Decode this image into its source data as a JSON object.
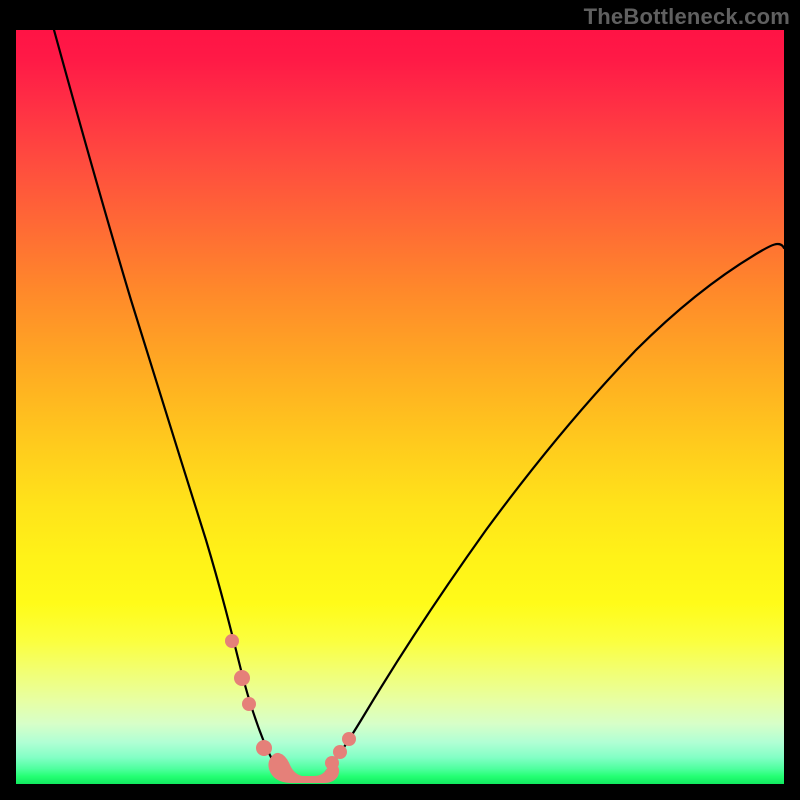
{
  "watermark": "TheBottleneck.com",
  "colors": {
    "background": "#000000",
    "gradient_top": "#ff1345",
    "gradient_mid": "#fff218",
    "gradient_bottom": "#11e95f",
    "curve": "#000000",
    "marker": "#e58079"
  },
  "chart_data": {
    "type": "line",
    "title": "",
    "xlabel": "",
    "ylabel": "",
    "xlim": [
      0,
      100
    ],
    "ylim": [
      0,
      100
    ],
    "background_gradient": {
      "orientation": "vertical",
      "stops": [
        {
          "pos": 0,
          "color": "#ff1345"
        },
        {
          "pos": 50,
          "color": "#ffcb1d"
        },
        {
          "pos": 80,
          "color": "#fbff3e"
        },
        {
          "pos": 100,
          "color": "#11e95f"
        }
      ]
    },
    "series": [
      {
        "name": "left-curve",
        "x": [
          5,
          7,
          9,
          11,
          13,
          15,
          17,
          19,
          21,
          23,
          25,
          27,
          28.5,
          30,
          31,
          32,
          33.5,
          35
        ],
        "y": [
          100,
          90,
          81,
          73,
          65.5,
          58.5,
          52,
          46,
          40,
          34,
          28,
          22,
          17,
          12,
          8.5,
          5.5,
          3,
          1
        ]
      },
      {
        "name": "right-curve",
        "x": [
          40,
          42,
          44,
          47,
          50,
          54,
          58,
          62,
          66,
          70,
          74,
          78,
          82,
          86,
          90,
          94,
          97,
          100
        ],
        "y": [
          1,
          3.5,
          6.5,
          10.5,
          15,
          20.5,
          26,
          31.5,
          37,
          42.5,
          47.5,
          52.5,
          57,
          61,
          64.5,
          67.5,
          69.5,
          71
        ]
      }
    ],
    "markers": [
      {
        "series": "left-curve",
        "x": 28,
        "y": 19
      },
      {
        "series": "left-curve",
        "x": 29.5,
        "y": 14
      },
      {
        "series": "left-curve",
        "x": 30.5,
        "y": 10.5
      },
      {
        "series": "left-curve",
        "x": 32.5,
        "y": 4.5
      },
      {
        "series": "right-curve",
        "x": 41,
        "y": 2.5
      },
      {
        "series": "right-curve",
        "x": 42.2,
        "y": 4
      },
      {
        "series": "right-curve",
        "x": 43.3,
        "y": 5.8
      }
    ],
    "flat_zone": {
      "x_start": 33,
      "x_end": 40.5,
      "y": 0.5
    }
  }
}
